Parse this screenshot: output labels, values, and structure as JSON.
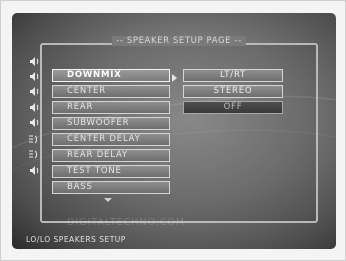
{
  "page": {
    "title": "-- SPEAKER SETUP PAGE --",
    "status_text": "LO/LO SPEAKERS SETUP",
    "watermark": "DIGITALTECHNO.COM"
  },
  "menu": {
    "items": [
      {
        "label": "DOWNMIX",
        "selected": true
      },
      {
        "label": "CENTER"
      },
      {
        "label": "REAR"
      },
      {
        "label": "SUBWOOFER"
      },
      {
        "label": "CENTER DELAY"
      },
      {
        "label": "REAR DELAY"
      },
      {
        "label": "TEST TONE"
      },
      {
        "label": "BASS"
      }
    ]
  },
  "options": {
    "items": [
      {
        "label": "LT/RT"
      },
      {
        "label": "STEREO"
      },
      {
        "label": "OFF",
        "state": "dim"
      }
    ]
  },
  "colors": {
    "selected_border": "#f2f2f2",
    "item_fill": "#7e7e7e",
    "background": "#6e6e6e"
  }
}
